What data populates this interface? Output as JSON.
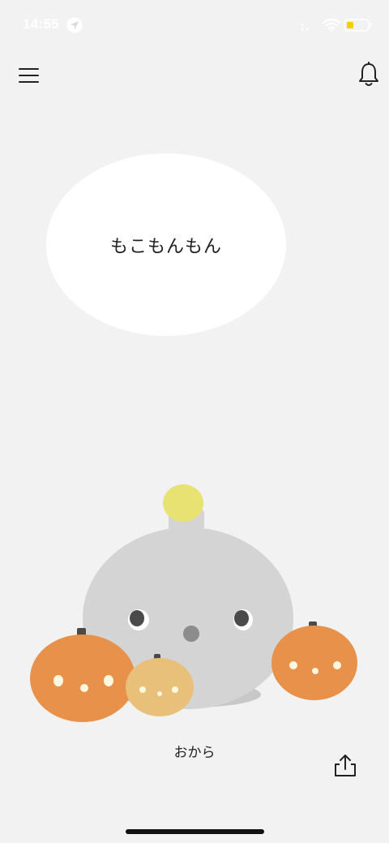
{
  "status_bar": {
    "time": "14:55",
    "icons": [
      "location-arrow-icon",
      "cellular-signal-icon",
      "wifi-icon",
      "battery-icon"
    ],
    "battery_color": "#f5d000"
  },
  "header": {
    "menu_icon": "hamburger-menu-icon",
    "notification_icon": "bell-icon"
  },
  "speech_bubble": {
    "text": "もこもんもん"
  },
  "character": {
    "name": "おから",
    "body_color": "#d4d4d4",
    "tuft_color": "#e8e272"
  },
  "decorations": {
    "pumpkin_color": "#e8914a",
    "small_pumpkin_color": "#e8c07a"
  },
  "footer": {
    "share_icon": "share-icon"
  },
  "colors": {
    "background": "#f2f2f2",
    "bubble": "#ffffff",
    "text": "#222222"
  }
}
